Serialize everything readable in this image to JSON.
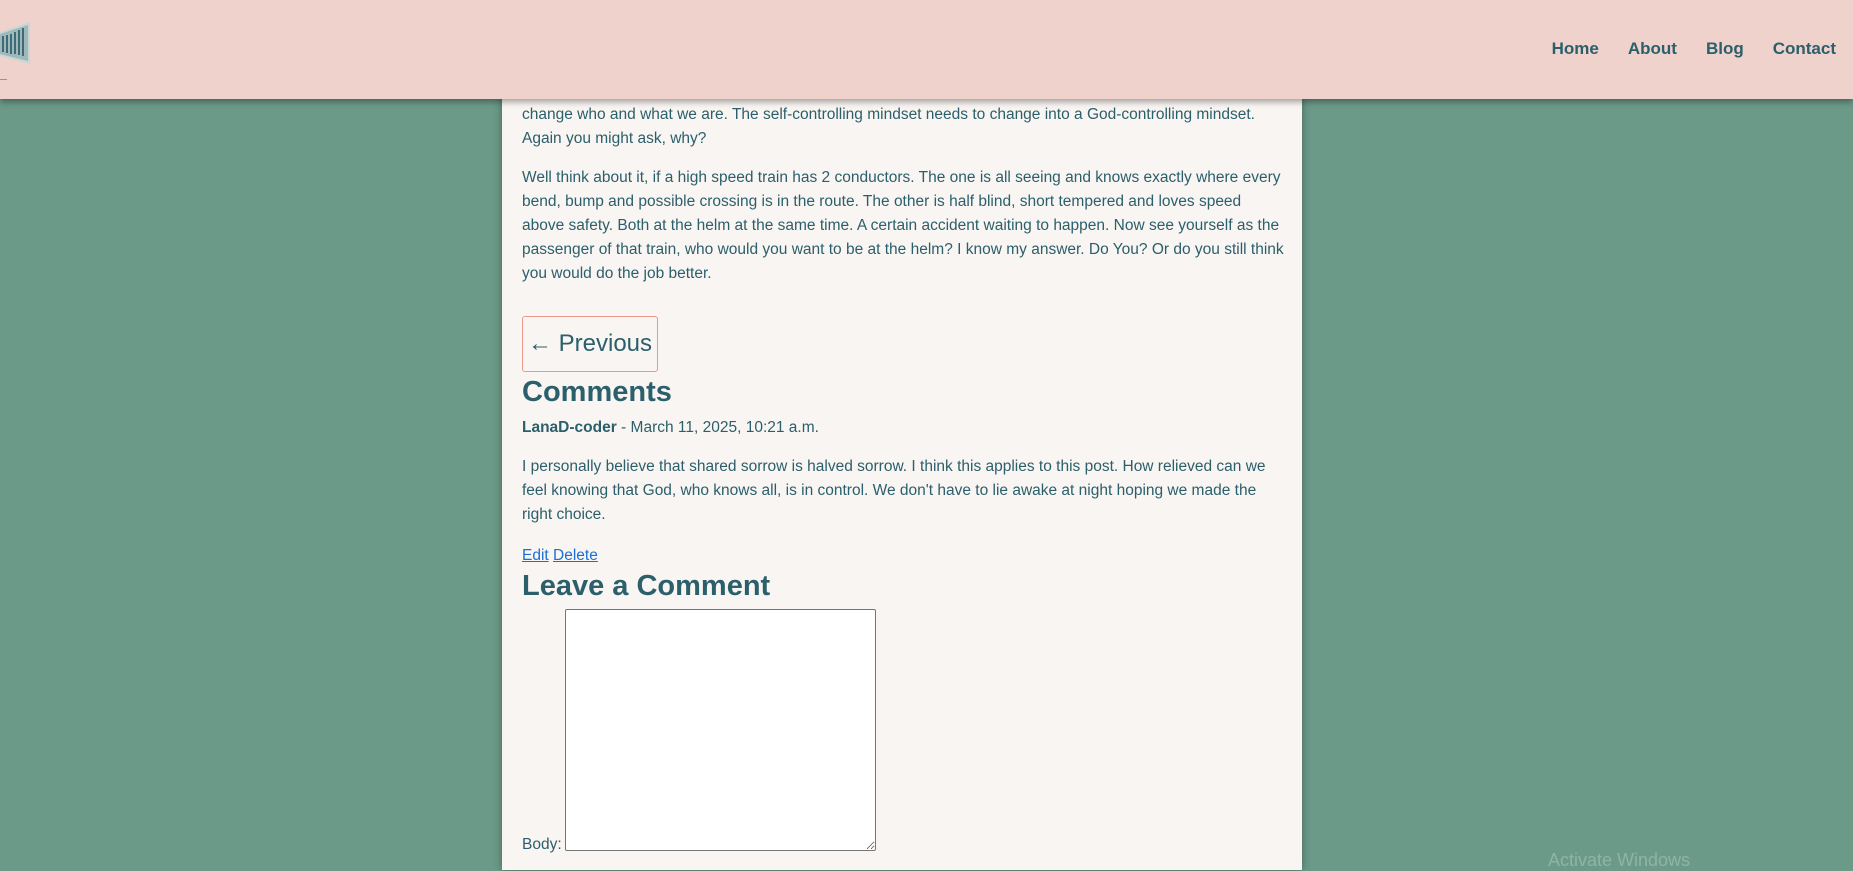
{
  "nav": {
    "links": [
      "Home",
      "About",
      "Blog",
      "Contact"
    ]
  },
  "post": {
    "paragraph_1": "change who and what we are. The self-controlling mindset needs to change into a God-controlling mindset. Again you might ask, why?",
    "paragraph_2": "Well think about it, if a high speed train has 2 conductors. The one is all seeing and knows exactly where every bend, bump and possible crossing is in the route. The other is half blind, short tempered and loves speed above safety. Both at the helm at the same time. A certain accident waiting to happen. Now see yourself as the passenger of that train, who would you want to be at the helm? I know my answer. Do You? Or do you still think you would do the job better."
  },
  "pagination": {
    "previous_label": "← Previous"
  },
  "comments": {
    "title": "Comments",
    "items": [
      {
        "author": "LanaD-coder",
        "separator": " - ",
        "date": "March 11, 2025, 10:21 a.m.",
        "body": "I personally believe that shared sorrow is halved sorrow. I think this applies to this post. How relieved can we feel knowing that God, who knows all, is in control. We don't have to lie awake at night hoping we made the right choice.",
        "edit_label": "Edit",
        "delete_label": "Delete"
      }
    ]
  },
  "comment_form": {
    "title": "Leave a Comment",
    "body_label": "Body:"
  },
  "os": {
    "watermark": "Activate Windows"
  },
  "colors": {
    "page_background": "#6b9a89",
    "navbar_background": "#efd2cb",
    "content_background": "#f9f5f2",
    "text": "#2b5f6b",
    "link": "#1a6fd6",
    "button_border": "#e8998a"
  }
}
